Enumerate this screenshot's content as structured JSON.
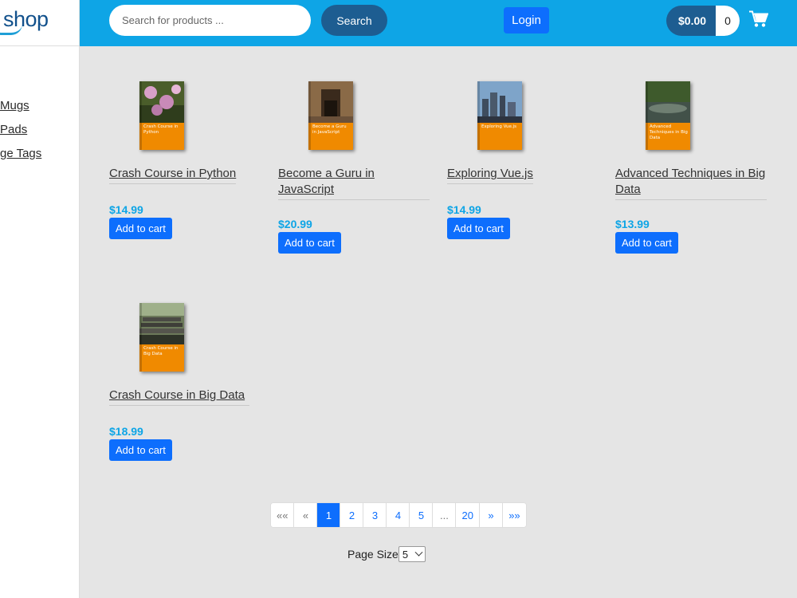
{
  "sidebar": {
    "logo_text": "shop",
    "categories": [
      "Mugs",
      "Pads",
      "ge Tags"
    ]
  },
  "header": {
    "search_placeholder": "Search for products ...",
    "search_label": "Search",
    "login_label": "Login",
    "cart_total": "$0.00",
    "cart_count": "0",
    "cart_icon": "shopping-cart-icon"
  },
  "products": [
    {
      "title": "Crash Course in Python",
      "price": "$14.99",
      "add_label": "Add to cart",
      "cover_title": "Crash Course in Python",
      "cover_color": "#f08a00"
    },
    {
      "title": "Become a Guru in JavaScript",
      "price": "$20.99",
      "add_label": "Add to cart",
      "cover_title": "Become a Guru in JavaScript",
      "cover_color": "#f08a00"
    },
    {
      "title": "Exploring Vue.js",
      "price": "$14.99",
      "add_label": "Add to cart",
      "cover_title": "Exploring Vue.js",
      "cover_color": "#f08a00"
    },
    {
      "title": "Advanced Techniques in Big Data",
      "price": "$13.99",
      "add_label": "Add to cart",
      "cover_title": "Advanced Techniques in Big Data",
      "cover_color": "#f08a00"
    },
    {
      "title": "Crash Course in Big Data",
      "price": "$18.99",
      "add_label": "Add to cart",
      "cover_title": "Crash Course in Big Data",
      "cover_color": "#f08a00"
    }
  ],
  "pagination": {
    "first": "««",
    "prev": "«",
    "pages": [
      "1",
      "2",
      "3",
      "4",
      "5"
    ],
    "ellipsis": "...",
    "last_page": "20",
    "next": "»",
    "last": "»»",
    "current": "1"
  },
  "page_size": {
    "label": "Page Size",
    "value": "5"
  },
  "colors": {
    "header": "#0ea5e6",
    "accent_dark": "#1d5d91",
    "button": "#0d6efd",
    "price": "#0ea5e6",
    "cover": "#f08a00"
  }
}
